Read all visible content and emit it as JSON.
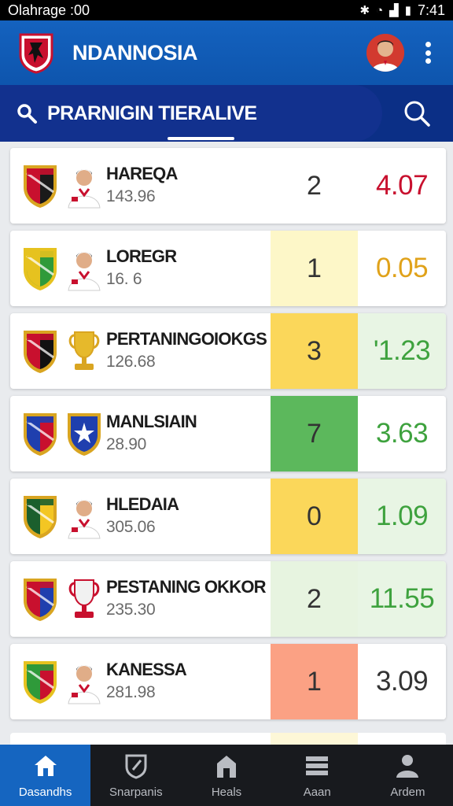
{
  "status_bar": {
    "carrier": "Olahrage :00",
    "time": "7:41"
  },
  "header": {
    "title": "NDANNOSIA"
  },
  "search": {
    "label": "PRARNIGIN TIERALIVE"
  },
  "matches": [
    {
      "name": "HAREQA",
      "sub": "143.96",
      "score": "2",
      "odds": "4.07",
      "mid_bg": "#ffffff",
      "odds_bg": "#ffffff",
      "odds_color": "#c8102e",
      "second_icon": "player"
    },
    {
      "name": "LOREGR",
      "sub": "16. 6",
      "score": "1",
      "odds": "0.05",
      "mid_bg": "#fdf7c8",
      "odds_bg": "#ffffff",
      "odds_color": "#e0a21a",
      "second_icon": "player"
    },
    {
      "name": "PERTANINGOIOKGS",
      "sub": "126.68",
      "score": "3",
      "odds": "'1.23",
      "mid_bg": "#fbd75a",
      "odds_bg": "#e8f5e4",
      "odds_color": "#3ea23e",
      "second_icon": "trophy"
    },
    {
      "name": "MANLSIAIN",
      "sub": "28.90",
      "score": "7",
      "odds": "3.63",
      "mid_bg": "#5cb85c",
      "odds_bg": "#ffffff",
      "odds_color": "#3ea23e",
      "second_icon": "crest"
    },
    {
      "name": "HLEDAIA",
      "sub": "305.06",
      "score": "0",
      "odds": "1.09",
      "mid_bg": "#fbd75a",
      "odds_bg": "#e8f5e4",
      "odds_color": "#3ea23e",
      "second_icon": "player"
    },
    {
      "name": "PESTANING OKKOR",
      "sub": "235.30",
      "score": "2",
      "odds": "11.55",
      "mid_bg": "#e7f4e0",
      "odds_bg": "#e8f5e4",
      "odds_color": "#3ea23e",
      "second_icon": "trophy-red"
    },
    {
      "name": "KANESSA",
      "sub": "281.98",
      "score": "1",
      "odds": "3.09",
      "mid_bg": "#fba184",
      "odds_bg": "#ffffff",
      "odds_color": "#333333",
      "second_icon": "player"
    }
  ],
  "crest_styles": [
    {
      "a": "#c8102e",
      "b": "#1a1a1a",
      "border": "#d9a521"
    },
    {
      "a": "#e6c21f",
      "b": "#2f9a3a",
      "border": "#e6c21f"
    },
    {
      "a": "#c8102e",
      "b": "#111111",
      "border": "#d9a521"
    },
    {
      "a": "#1f3fae",
      "b": "#c8102e",
      "border": "#d9a521"
    },
    {
      "a": "#1b5f2d",
      "b": "#f3c623",
      "border": "#d9a521"
    },
    {
      "a": "#c8102e",
      "b": "#1f3fae",
      "border": "#d9a521"
    },
    {
      "a": "#2f9a3a",
      "b": "#c8102e",
      "border": "#e6c21f"
    }
  ],
  "nav": [
    {
      "label": "Dasandhs",
      "icon": "home-icon",
      "active": true
    },
    {
      "label": "Snarpanis",
      "icon": "shield-icon",
      "active": false
    },
    {
      "label": "Heals",
      "icon": "stadium-icon",
      "active": false
    },
    {
      "label": "Aaan",
      "icon": "list-icon",
      "active": false
    },
    {
      "label": "Ardem",
      "icon": "person-icon",
      "active": false
    }
  ],
  "colors": {
    "primary": "#1462bf",
    "dark_navy": "#0b2f86",
    "nav_bg": "#181a1e"
  }
}
